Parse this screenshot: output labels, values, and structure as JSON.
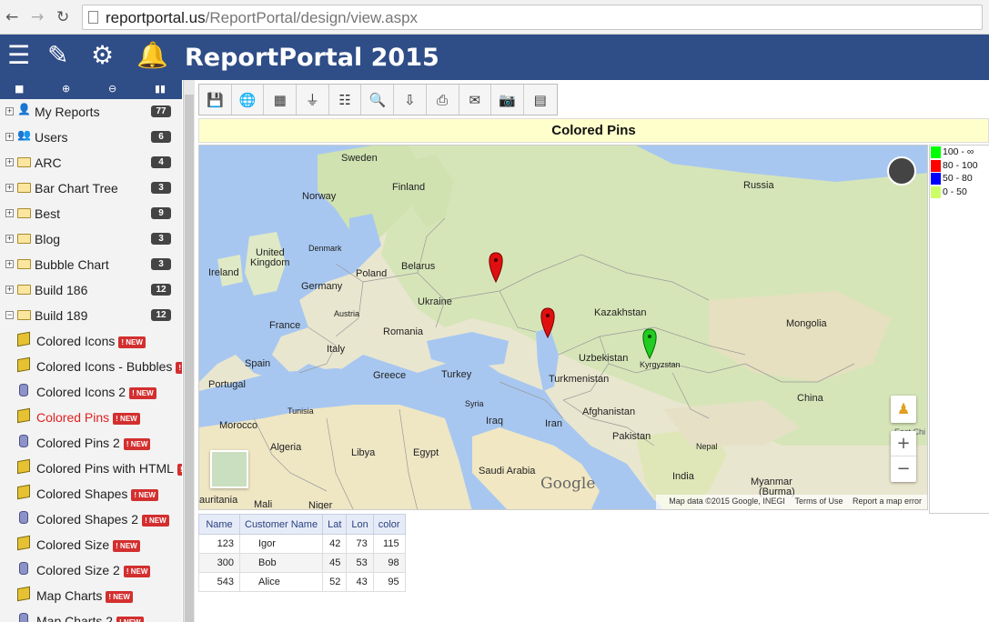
{
  "browser": {
    "back": "←",
    "forward": "→",
    "reload": "↻",
    "url_host": "reportportal.us",
    "url_path": "/ReportPortal/design/view.aspx"
  },
  "header": {
    "title": "ReportPortal 2015",
    "icons": [
      "menu-icon",
      "edit-icon",
      "gears-icon",
      "bell-icon"
    ]
  },
  "sidebar": {
    "toolbar_icons": [
      "folder-icon",
      "add-icon",
      "remove-icon",
      "binoculars-icon"
    ],
    "folders": [
      {
        "label": "My Reports",
        "count": "77",
        "icon": "user-icon",
        "expand": "+"
      },
      {
        "label": "Users",
        "count": "6",
        "icon": "users-icon",
        "expand": "+"
      },
      {
        "label": "ARC",
        "count": "4",
        "icon": "folder-icon",
        "expand": "+"
      },
      {
        "label": "Bar Chart Tree",
        "count": "3",
        "icon": "folder-icon",
        "expand": "+"
      },
      {
        "label": "Best",
        "count": "9",
        "icon": "folder-icon",
        "expand": "+"
      },
      {
        "label": "Blog",
        "count": "3",
        "icon": "folder-icon",
        "expand": "+"
      },
      {
        "label": "Bubble Chart",
        "count": "3",
        "icon": "folder-icon",
        "expand": "+"
      },
      {
        "label": "Build 186",
        "count": "12",
        "icon": "folder-icon",
        "expand": "+"
      },
      {
        "label": "Build 189",
        "count": "12",
        "icon": "folder-open-icon",
        "expand": "−"
      }
    ],
    "new_badge": "! NEW",
    "reports": [
      {
        "label": "Colored Icons",
        "icon": "cube-icon"
      },
      {
        "label": "Colored Icons - Bubbles",
        "icon": "cube-icon"
      },
      {
        "label": "Colored Icons 2",
        "icon": "database-icon"
      },
      {
        "label": "Colored Pins",
        "icon": "cube-icon",
        "active": true
      },
      {
        "label": "Colored Pins 2",
        "icon": "database-icon"
      },
      {
        "label": "Colored Pins with HTML",
        "icon": "cube-icon"
      },
      {
        "label": "Colored Shapes",
        "icon": "cube-icon"
      },
      {
        "label": "Colored Shapes 2",
        "icon": "database-icon"
      },
      {
        "label": "Colored Size",
        "icon": "cube-icon"
      },
      {
        "label": "Colored Size 2",
        "icon": "database-icon"
      },
      {
        "label": "Map Charts",
        "icon": "cube-icon"
      },
      {
        "label": "Map Charts 2",
        "icon": "database-icon"
      }
    ]
  },
  "toolbar": {
    "buttons": [
      "save-icon",
      "globe-icon",
      "grid-icon",
      "filter-icon",
      "filter-list-icon",
      "search-icon",
      "export-icon",
      "print-icon",
      "email-icon",
      "camera-icon",
      "document-icon"
    ]
  },
  "report": {
    "title": "Colored Pins"
  },
  "map": {
    "labels": {
      "sweden": "Sweden",
      "finland": "Finland",
      "norway": "Norway",
      "russia": "Russia",
      "denmark": "Denmark",
      "united_kingdom_1": "United",
      "united_kingdom_2": "Kingdom",
      "ireland": "Ireland",
      "belarus": "Belarus",
      "poland": "Poland",
      "germany": "Germany",
      "ukraine": "Ukraine",
      "kazakhstan": "Kazakhstan",
      "mongolia": "Mongolia",
      "france": "France",
      "austria": "Austria",
      "romania": "Romania",
      "italy": "Italy",
      "spain": "Spain",
      "portugal": "Portugal",
      "greece": "Greece",
      "turkey": "Turkey",
      "uzbekistan": "Uzbekistan",
      "kyrgyzstan": "Kyrgyzstan",
      "turkmenistan": "Turkmenistan",
      "syria": "Syria",
      "iraq": "Iraq",
      "iran": "Iran",
      "afghanistan": "Afghanistan",
      "china": "China",
      "tunisia": "Tunisia",
      "morocco": "Morocco",
      "algeria": "Algeria",
      "libya": "Libya",
      "egypt": "Egypt",
      "pakistan": "Pakistan",
      "nepal": "Nepal",
      "saudi_arabia": "Saudi Arabia",
      "india": "India",
      "myanmar": "Myanmar",
      "burma": "(Burma)",
      "mali": "Mali",
      "niger": "Niger",
      "mauritania": "auritania",
      "east_china": "East Chi"
    },
    "google": "Google",
    "attribution": {
      "data": "Map data ©2015 Google, INEGI",
      "terms": "Terms of Use",
      "report": "Report a map error"
    },
    "zoom_in": "+",
    "zoom_out": "−",
    "pegman": "♟",
    "pins": [
      {
        "name": "Igor",
        "lat": 42,
        "lon": 73,
        "color": "#22cc22"
      },
      {
        "name": "Bob",
        "lat": 45,
        "lon": 53,
        "color": "#e01010"
      },
      {
        "name": "Alice",
        "lat": 52,
        "lon": 43,
        "color": "#e01010"
      }
    ]
  },
  "legend": [
    {
      "color": "#00ff00",
      "label": "100 - ∞"
    },
    {
      "color": "#ff0000",
      "label": "80   - 100"
    },
    {
      "color": "#0000ff",
      "label": "50   - 80"
    },
    {
      "color": "#ccff66",
      "label": "0     - 50"
    }
  ],
  "table": {
    "headers": [
      "Name",
      "Customer Name",
      "Lat",
      "Lon",
      "color"
    ],
    "rows": [
      [
        "123",
        "Igor",
        "42",
        "73",
        "115"
      ],
      [
        "300",
        "Bob",
        "45",
        "53",
        "98"
      ],
      [
        "543",
        "Alice",
        "52",
        "43",
        "95"
      ]
    ]
  }
}
